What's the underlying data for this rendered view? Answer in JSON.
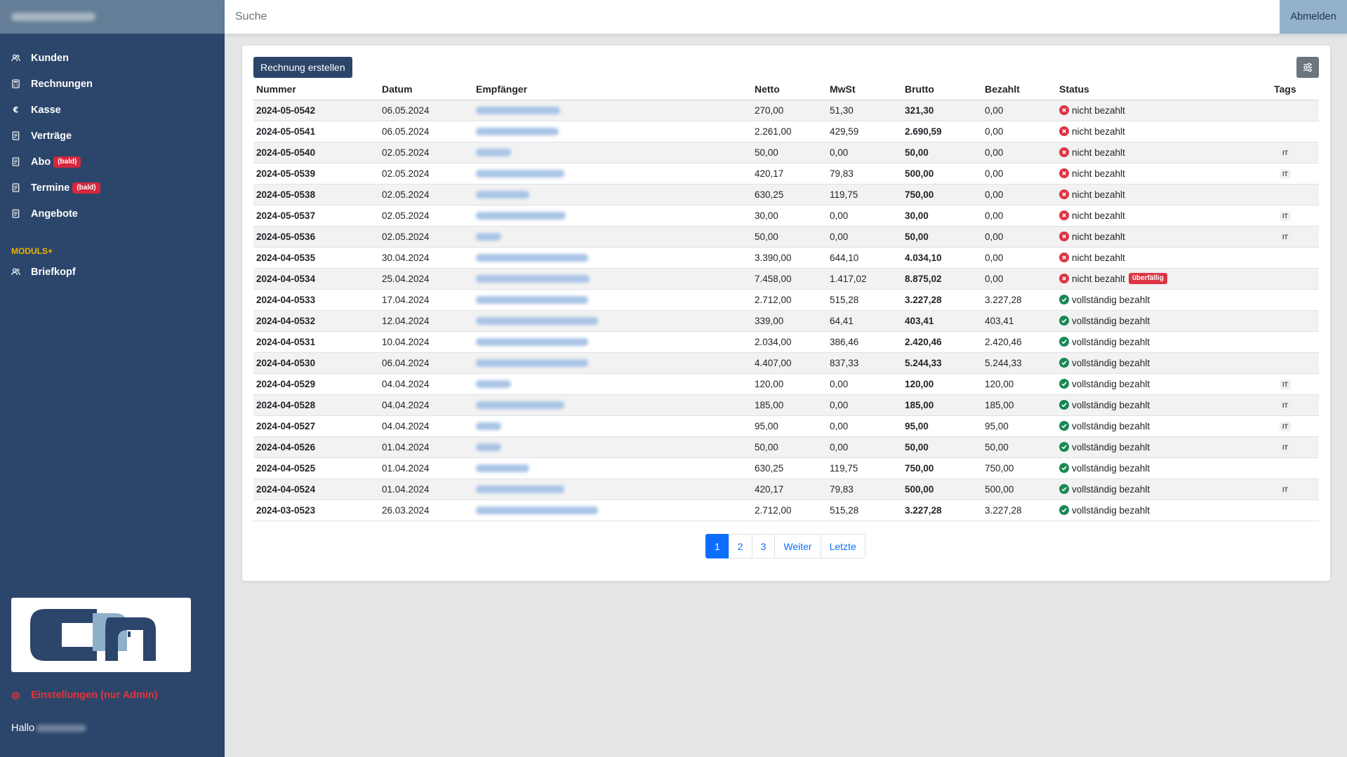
{
  "sidebar": {
    "nav_items": [
      {
        "label": "Kunden",
        "icon": "users-icon"
      },
      {
        "label": "Rechnungen",
        "icon": "calculator-icon"
      },
      {
        "label": "Kasse",
        "icon": "euro-icon"
      },
      {
        "label": "Verträge",
        "icon": "document-icon"
      },
      {
        "label": "Abo",
        "icon": "document-icon",
        "badge": "(bald)"
      },
      {
        "label": "Termine",
        "icon": "document-icon",
        "badge": "(bald)"
      },
      {
        "label": "Angebote",
        "icon": "document-icon"
      }
    ],
    "section_title": "MODULS+",
    "module_items": [
      {
        "label": "Briefkopf",
        "icon": "users-icon"
      }
    ],
    "settings_label": "Einstellungen (nur Admin)",
    "greeting": "Hallo"
  },
  "topbar": {
    "search_placeholder": "Suche",
    "logout_label": "Abmelden"
  },
  "main": {
    "create_button": "Rechnung erstellen",
    "columns": [
      "Nummer",
      "Datum",
      "Empfänger",
      "Netto",
      "MwSt",
      "Brutto",
      "Bezahlt",
      "Status",
      "Tags"
    ],
    "rows": [
      {
        "nummer": "2024-05-0542",
        "datum": "06.05.2024",
        "netto": "270,00",
        "mwst": "51,30",
        "brutto": "321,30",
        "bezahlt": "0,00",
        "status": "nicht bezahlt",
        "paid": false,
        "overdue": "",
        "tag": ""
      },
      {
        "nummer": "2024-05-0541",
        "datum": "06.05.2024",
        "netto": "2.261,00",
        "mwst": "429,59",
        "brutto": "2.690,59",
        "bezahlt": "0,00",
        "status": "nicht bezahlt",
        "paid": false,
        "overdue": "",
        "tag": ""
      },
      {
        "nummer": "2024-05-0540",
        "datum": "02.05.2024",
        "netto": "50,00",
        "mwst": "0,00",
        "brutto": "50,00",
        "bezahlt": "0,00",
        "status": "nicht bezahlt",
        "paid": false,
        "overdue": "",
        "tag": "IT"
      },
      {
        "nummer": "2024-05-0539",
        "datum": "02.05.2024",
        "netto": "420,17",
        "mwst": "79,83",
        "brutto": "500,00",
        "bezahlt": "0,00",
        "status": "nicht bezahlt",
        "paid": false,
        "overdue": "",
        "tag": "IT"
      },
      {
        "nummer": "2024-05-0538",
        "datum": "02.05.2024",
        "netto": "630,25",
        "mwst": "119,75",
        "brutto": "750,00",
        "bezahlt": "0,00",
        "status": "nicht bezahlt",
        "paid": false,
        "overdue": "",
        "tag": ""
      },
      {
        "nummer": "2024-05-0537",
        "datum": "02.05.2024",
        "netto": "30,00",
        "mwst": "0,00",
        "brutto": "30,00",
        "bezahlt": "0,00",
        "status": "nicht bezahlt",
        "paid": false,
        "overdue": "",
        "tag": "IT"
      },
      {
        "nummer": "2024-05-0536",
        "datum": "02.05.2024",
        "netto": "50,00",
        "mwst": "0,00",
        "brutto": "50,00",
        "bezahlt": "0,00",
        "status": "nicht bezahlt",
        "paid": false,
        "overdue": "",
        "tag": "IT"
      },
      {
        "nummer": "2024-04-0535",
        "datum": "30.04.2024",
        "netto": "3.390,00",
        "mwst": "644,10",
        "brutto": "4.034,10",
        "bezahlt": "0,00",
        "status": "nicht bezahlt",
        "paid": false,
        "overdue": "",
        "tag": ""
      },
      {
        "nummer": "2024-04-0534",
        "datum": "25.04.2024",
        "netto": "7.458,00",
        "mwst": "1.417,02",
        "brutto": "8.875,02",
        "bezahlt": "0,00",
        "status": "nicht bezahlt",
        "paid": false,
        "overdue": "überfällig",
        "tag": ""
      },
      {
        "nummer": "2024-04-0533",
        "datum": "17.04.2024",
        "netto": "2.712,00",
        "mwst": "515,28",
        "brutto": "3.227,28",
        "bezahlt": "3.227,28",
        "status": "vollständig bezahlt",
        "paid": true,
        "overdue": "",
        "tag": ""
      },
      {
        "nummer": "2024-04-0532",
        "datum": "12.04.2024",
        "netto": "339,00",
        "mwst": "64,41",
        "brutto": "403,41",
        "bezahlt": "403,41",
        "status": "vollständig bezahlt",
        "paid": true,
        "overdue": "",
        "tag": ""
      },
      {
        "nummer": "2024-04-0531",
        "datum": "10.04.2024",
        "netto": "2.034,00",
        "mwst": "386,46",
        "brutto": "2.420,46",
        "bezahlt": "2.420,46",
        "status": "vollständig bezahlt",
        "paid": true,
        "overdue": "",
        "tag": ""
      },
      {
        "nummer": "2024-04-0530",
        "datum": "06.04.2024",
        "netto": "4.407,00",
        "mwst": "837,33",
        "brutto": "5.244,33",
        "bezahlt": "5.244,33",
        "status": "vollständig bezahlt",
        "paid": true,
        "overdue": "",
        "tag": ""
      },
      {
        "nummer": "2024-04-0529",
        "datum": "04.04.2024",
        "netto": "120,00",
        "mwst": "0,00",
        "brutto": "120,00",
        "bezahlt": "120,00",
        "status": "vollständig bezahlt",
        "paid": true,
        "overdue": "",
        "tag": "IT"
      },
      {
        "nummer": "2024-04-0528",
        "datum": "04.04.2024",
        "netto": "185,00",
        "mwst": "0,00",
        "brutto": "185,00",
        "bezahlt": "185,00",
        "status": "vollständig bezahlt",
        "paid": true,
        "overdue": "",
        "tag": "IT"
      },
      {
        "nummer": "2024-04-0527",
        "datum": "04.04.2024",
        "netto": "95,00",
        "mwst": "0,00",
        "brutto": "95,00",
        "bezahlt": "95,00",
        "status": "vollständig bezahlt",
        "paid": true,
        "overdue": "",
        "tag": "IT"
      },
      {
        "nummer": "2024-04-0526",
        "datum": "01.04.2024",
        "netto": "50,00",
        "mwst": "0,00",
        "brutto": "50,00",
        "bezahlt": "50,00",
        "status": "vollständig bezahlt",
        "paid": true,
        "overdue": "",
        "tag": "IT"
      },
      {
        "nummer": "2024-04-0525",
        "datum": "01.04.2024",
        "netto": "630,25",
        "mwst": "119,75",
        "brutto": "750,00",
        "bezahlt": "750,00",
        "status": "vollständig bezahlt",
        "paid": true,
        "overdue": "",
        "tag": ""
      },
      {
        "nummer": "2024-04-0524",
        "datum": "01.04.2024",
        "netto": "420,17",
        "mwst": "79,83",
        "brutto": "500,00",
        "bezahlt": "500,00",
        "status": "vollständig bezahlt",
        "paid": true,
        "overdue": "",
        "tag": "IT"
      },
      {
        "nummer": "2024-03-0523",
        "datum": "26.03.2024",
        "netto": "2.712,00",
        "mwst": "515,28",
        "brutto": "3.227,28",
        "bezahlt": "3.227,28",
        "status": "vollständig bezahlt",
        "paid": true,
        "overdue": "",
        "tag": ""
      }
    ],
    "pagination": [
      "1",
      "2",
      "3",
      "Weiter",
      "Letzte"
    ],
    "active_page": "1"
  },
  "colors": {
    "sidebar_bg": "#2c456a",
    "brand_bg": "#637e96",
    "accent_blue": "#0d6efd",
    "status_red": "#dc3545",
    "status_green": "#198754",
    "section_title": "#f0b400",
    "logout_bg": "#93b2c9"
  }
}
